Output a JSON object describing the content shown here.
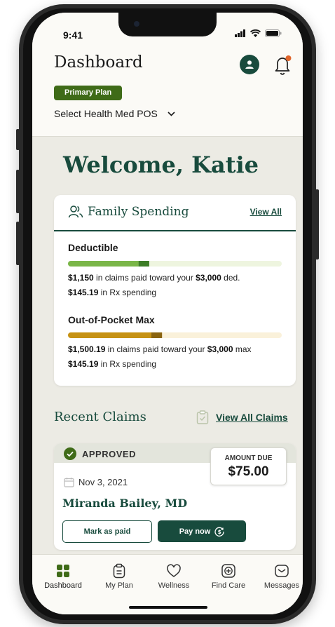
{
  "status_bar": {
    "time": "9:41"
  },
  "header": {
    "title": "Dashboard",
    "plan_badge": "Primary Plan",
    "plan_name": "Select Health Med POS"
  },
  "welcome": "Welcome, Katie",
  "family_spending": {
    "title": "Family Spending",
    "view_all": "View All",
    "deductible": {
      "label": "Deductible",
      "claims_paid": "$1,150",
      "claims_text": " in claims paid toward your ",
      "total": "$3,000",
      "suffix": " ded.",
      "rx_amount": "$145.19",
      "rx_text": " in Rx spending",
      "paid_fraction": 0.38,
      "rx_fraction": 0.05
    },
    "oop_max": {
      "label": "Out-of-Pocket Max",
      "claims_paid": "$1,500.19",
      "claims_text": " in claims paid toward your ",
      "total": "$3,000",
      "suffix": " max",
      "rx_amount": "$145.19",
      "rx_text": " in Rx spending",
      "paid_fraction": 0.44,
      "rx_fraction": 0.05
    }
  },
  "recent_claims": {
    "title": "Recent Claims",
    "view_all": "View All Claims",
    "claim": {
      "status": "APPROVED",
      "amount_label": "AMOUNT DUE",
      "amount": "$75.00",
      "date": "Nov 3, 2021",
      "provider": "Miranda Bailey, MD",
      "mark_paid": "Mark as paid",
      "pay_now": "Pay now"
    }
  },
  "tabs": [
    {
      "label": "Dashboard",
      "icon": "grid-icon"
    },
    {
      "label": "My Plan",
      "icon": "clipboard-icon"
    },
    {
      "label": "Wellness",
      "icon": "heart-icon"
    },
    {
      "label": "Find Care",
      "icon": "plus-square-icon"
    },
    {
      "label": "Messages",
      "icon": "message-icon"
    }
  ],
  "colors": {
    "primary": "#184b3d",
    "deductible_bar": "#7ab648",
    "deductible_rx": "#3c7d26",
    "deductible_track": "#eef5df",
    "oop_bar": "#c69214",
    "oop_rx": "#8a6410",
    "oop_track": "#faf1da",
    "badge": "#3f6b18",
    "notification_dot": "#e0652b"
  }
}
